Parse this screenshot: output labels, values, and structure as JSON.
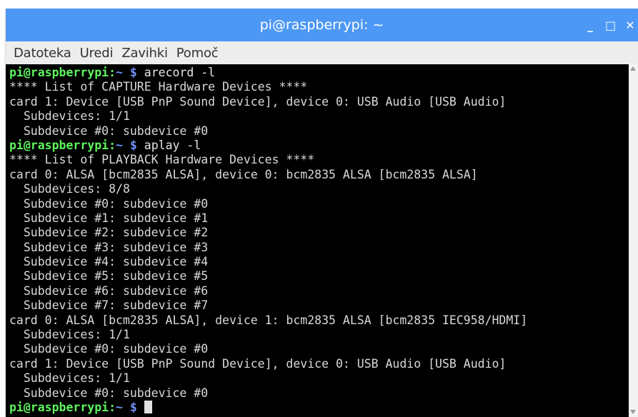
{
  "window": {
    "title": "pi@raspberrypi: ~",
    "controls": {
      "minimize": "_",
      "maximize": "□",
      "close": "✕"
    }
  },
  "menu": [
    "Datoteka",
    "Uredi",
    "Zavihki",
    "Pomoč"
  ],
  "colors": {
    "titlebar": "#4d98f5",
    "prompt": "#5ff35f",
    "path": "#6f8ff7",
    "terminal_bg": "#000000",
    "terminal_fg": "#d9d9d9"
  },
  "terminal": {
    "lines": [
      {
        "type": "prompt",
        "user": "pi@raspberrypi:",
        "path": "~",
        "symbol": "$",
        "command": "arecord -l"
      },
      {
        "type": "output",
        "text": "**** List of CAPTURE Hardware Devices ****"
      },
      {
        "type": "output",
        "text": "card 1: Device [USB PnP Sound Device], device 0: USB Audio [USB Audio]"
      },
      {
        "type": "output",
        "text": "  Subdevices: 1/1"
      },
      {
        "type": "output",
        "text": "  Subdevice #0: subdevice #0"
      },
      {
        "type": "prompt",
        "user": "pi@raspberrypi:",
        "path": "~",
        "symbol": "$",
        "command": "aplay -l"
      },
      {
        "type": "output",
        "text": "**** List of PLAYBACK Hardware Devices ****"
      },
      {
        "type": "output",
        "text": "card 0: ALSA [bcm2835 ALSA], device 0: bcm2835 ALSA [bcm2835 ALSA]"
      },
      {
        "type": "output",
        "text": "  Subdevices: 8/8"
      },
      {
        "type": "output",
        "text": "  Subdevice #0: subdevice #0"
      },
      {
        "type": "output",
        "text": "  Subdevice #1: subdevice #1"
      },
      {
        "type": "output",
        "text": "  Subdevice #2: subdevice #2"
      },
      {
        "type": "output",
        "text": "  Subdevice #3: subdevice #3"
      },
      {
        "type": "output",
        "text": "  Subdevice #4: subdevice #4"
      },
      {
        "type": "output",
        "text": "  Subdevice #5: subdevice #5"
      },
      {
        "type": "output",
        "text": "  Subdevice #6: subdevice #6"
      },
      {
        "type": "output",
        "text": "  Subdevice #7: subdevice #7"
      },
      {
        "type": "output",
        "text": "card 0: ALSA [bcm2835 ALSA], device 1: bcm2835 ALSA [bcm2835 IEC958/HDMI]"
      },
      {
        "type": "output",
        "text": "  Subdevices: 1/1"
      },
      {
        "type": "output",
        "text": "  Subdevice #0: subdevice #0"
      },
      {
        "type": "output",
        "text": "card 1: Device [USB PnP Sound Device], device 0: USB Audio [USB Audio]"
      },
      {
        "type": "output",
        "text": "  Subdevices: 1/1"
      },
      {
        "type": "output",
        "text": "  Subdevice #0: subdevice #0"
      },
      {
        "type": "prompt",
        "user": "pi@raspberrypi:",
        "path": "~",
        "symbol": "$",
        "command": "",
        "cursor": true
      }
    ]
  }
}
